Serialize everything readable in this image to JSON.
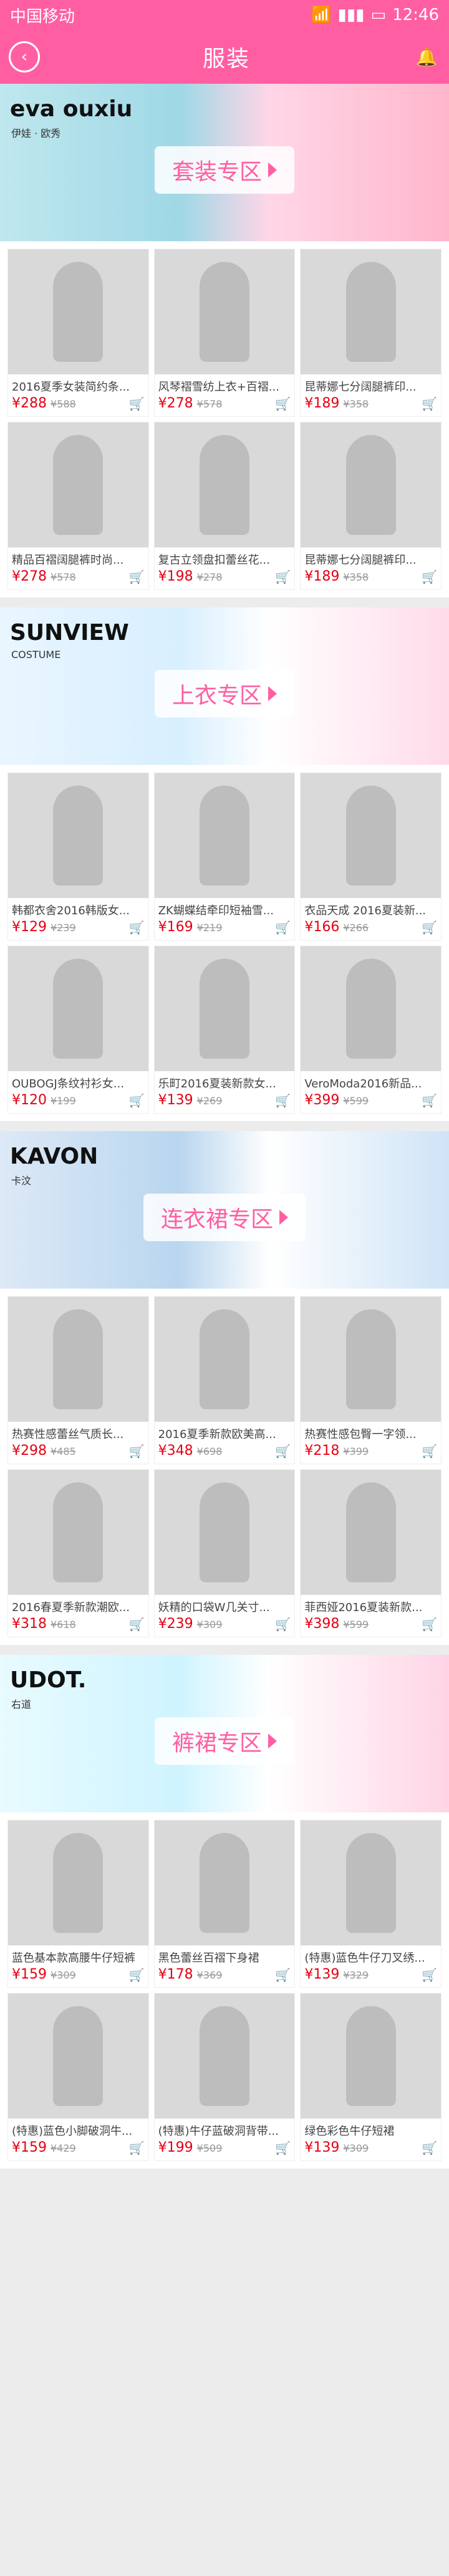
{
  "status": {
    "carrier": "中国移动",
    "time": "12:46"
  },
  "nav": {
    "title": "服装"
  },
  "sections": [
    {
      "banner": {
        "brand": "eva ouxiu",
        "sub": "伊娃 · 欧秀",
        "label": "套装专区"
      },
      "items": [
        {
          "name": "2016夏季女装简约条...",
          "price": "¥288",
          "old": "¥588"
        },
        {
          "name": "风琴褶雪纺上衣+百褶...",
          "price": "¥278",
          "old": "¥578"
        },
        {
          "name": "昆蒂娜七分阔腿裤印...",
          "price": "¥189",
          "old": "¥358"
        },
        {
          "name": "精品百褶阔腿裤时尚...",
          "price": "¥278",
          "old": "¥578"
        },
        {
          "name": "复古立领盘扣蕾丝花...",
          "price": "¥198",
          "old": "¥278"
        },
        {
          "name": "昆蒂娜七分阔腿裤印...",
          "price": "¥189",
          "old": "¥358"
        }
      ]
    },
    {
      "banner": {
        "brand": "SUNVIEW",
        "sub": "COSTUME",
        "label": "上衣专区"
      },
      "items": [
        {
          "name": "韩都衣舍2016韩版女...",
          "price": "¥129",
          "old": "¥239"
        },
        {
          "name": "ZK蝴蝶结牵印短袖雪...",
          "price": "¥169",
          "old": "¥219"
        },
        {
          "name": "衣品天成 2016夏装新...",
          "price": "¥166",
          "old": "¥266"
        },
        {
          "name": "OUBOGJ条纹衬衫女...",
          "price": "¥120",
          "old": "¥199"
        },
        {
          "name": "乐町2016夏装新款女...",
          "price": "¥139",
          "old": "¥269"
        },
        {
          "name": "VeroModa2016新品...",
          "price": "¥399",
          "old": "¥599"
        }
      ]
    },
    {
      "banner": {
        "brand": "KAVON",
        "sub": "卡汶",
        "label": "连衣裙专区"
      },
      "items": [
        {
          "name": "热赛性感蕾丝气质长...",
          "price": "¥298",
          "old": "¥485"
        },
        {
          "name": "2016夏季新款欧美高...",
          "price": "¥348",
          "old": "¥698"
        },
        {
          "name": "热赛性感包臀一字领...",
          "price": "¥218",
          "old": "¥399"
        },
        {
          "name": "2016春夏季新款潮欧...",
          "price": "¥318",
          "old": "¥618"
        },
        {
          "name": "妖精的口袋W几关寸...",
          "price": "¥239",
          "old": "¥309"
        },
        {
          "name": "菲西娅2016夏装新款...",
          "price": "¥398",
          "old": "¥599"
        }
      ]
    },
    {
      "banner": {
        "brand": "UDOT.",
        "sub": "右道",
        "label": "裤裙专区"
      },
      "items": [
        {
          "name": "蓝色基本款高腰牛仔短裤",
          "price": "¥159",
          "old": "¥309"
        },
        {
          "name": "黑色蕾丝百褶下身裙",
          "price": "¥178",
          "old": "¥369"
        },
        {
          "name": "(特惠)蓝色牛仔刀叉绣...",
          "price": "¥139",
          "old": "¥329"
        },
        {
          "name": "(特惠)蓝色小脚破洞牛...",
          "price": "¥159",
          "old": "¥429"
        },
        {
          "name": "(特惠)牛仔蓝破洞背带...",
          "price": "¥199",
          "old": "¥509"
        },
        {
          "name": "绿色彩色牛仔短裙",
          "price": "¥139",
          "old": "¥309"
        }
      ]
    }
  ],
  "icons": {
    "back": "back-icon",
    "bell": "bell-icon",
    "cart": "cart-icon"
  },
  "colors": {
    "accent": "#ff5fa2",
    "price": "#e60012"
  }
}
